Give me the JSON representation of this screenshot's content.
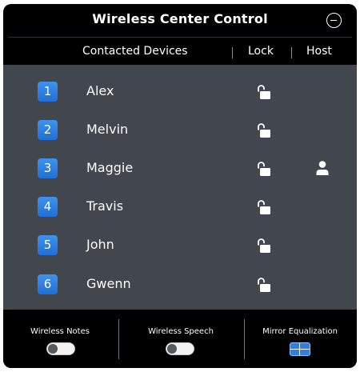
{
  "window": {
    "title": "Wireless Center Control"
  },
  "columns": {
    "devices": "Contacted Devices",
    "lock": "Lock",
    "host": "Host"
  },
  "devices": [
    {
      "number": "1",
      "name": "Alex",
      "lock": "unlocked",
      "host": false
    },
    {
      "number": "2",
      "name": "Melvin",
      "lock": "unlocked",
      "host": false
    },
    {
      "number": "3",
      "name": "Maggie",
      "lock": "unlocked",
      "host": true
    },
    {
      "number": "4",
      "name": "Travis",
      "lock": "unlocked",
      "host": false
    },
    {
      "number": "5",
      "name": "John",
      "lock": "unlocked",
      "host": false
    },
    {
      "number": "6",
      "name": "Gwenn",
      "lock": "unlocked",
      "host": false
    }
  ],
  "icons": {
    "lock": "unlocked-padlock-icon",
    "host": "person-icon",
    "minimize": "minus-circle-icon",
    "mirror": "grid-icon"
  },
  "bottom": {
    "notes_label": "Wireless Notes",
    "notes_on": false,
    "speech_label": "Wireless Speech",
    "speech_on": false,
    "mirror_label": "Mirror Equalization"
  },
  "colors": {
    "accent": "#2e7fe0",
    "list_bg": "#41474d",
    "window_bg": "#000000"
  }
}
